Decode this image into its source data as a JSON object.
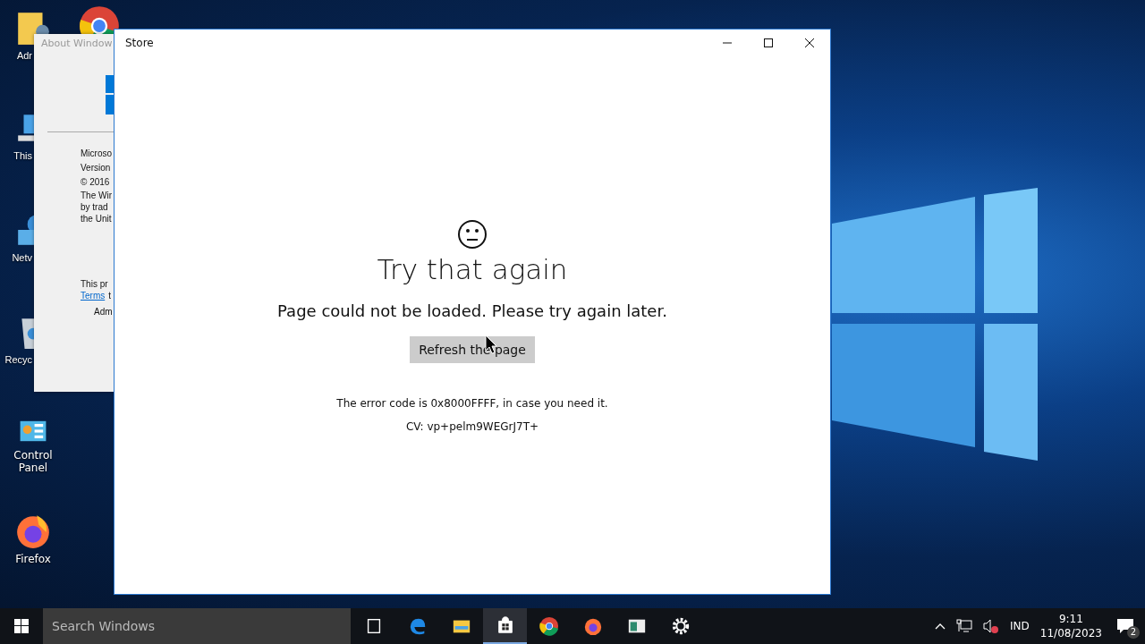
{
  "desktop_icons": [
    {
      "label": "Adr",
      "kind": "user"
    },
    {
      "label": "This",
      "kind": "pc"
    },
    {
      "label": "Netv",
      "kind": "network"
    },
    {
      "label": "Recyc",
      "kind": "recycle"
    },
    {
      "label": "Control Panel",
      "kind": "control"
    },
    {
      "label": "Firefox",
      "kind": "firefox"
    }
  ],
  "about_window": {
    "title": "About Window",
    "lines": [
      "Microso",
      "Version",
      "© 2016"
    ],
    "paragraph": [
      "The Wir",
      "by trad",
      "the Unit"
    ],
    "license": "This pr",
    "link": "Terms",
    "link_tail": "t",
    "user": "Adm"
  },
  "store_window": {
    "title": "Store",
    "heading": "Try that again",
    "message": "Page could not be loaded. Please try again later.",
    "button": "Refresh the page",
    "error": "The error code is 0x8000FFFF, in case you need it.",
    "cv": "CV: vp+pelm9WEGrJ7T+"
  },
  "taskbar": {
    "search": {
      "placeholder": "Search Windows"
    },
    "apps": [
      {
        "kind": "taskview",
        "selected": false
      },
      {
        "kind": "edge",
        "selected": false
      },
      {
        "kind": "explorer",
        "selected": false
      },
      {
        "kind": "store",
        "selected": true
      },
      {
        "kind": "chrome",
        "selected": false
      },
      {
        "kind": "firefox",
        "selected": false
      },
      {
        "kind": "app",
        "selected": false
      },
      {
        "kind": "settings",
        "selected": false
      }
    ],
    "language": "IND",
    "time": "9:11",
    "date": "11/08/2023",
    "notifications": "2"
  }
}
